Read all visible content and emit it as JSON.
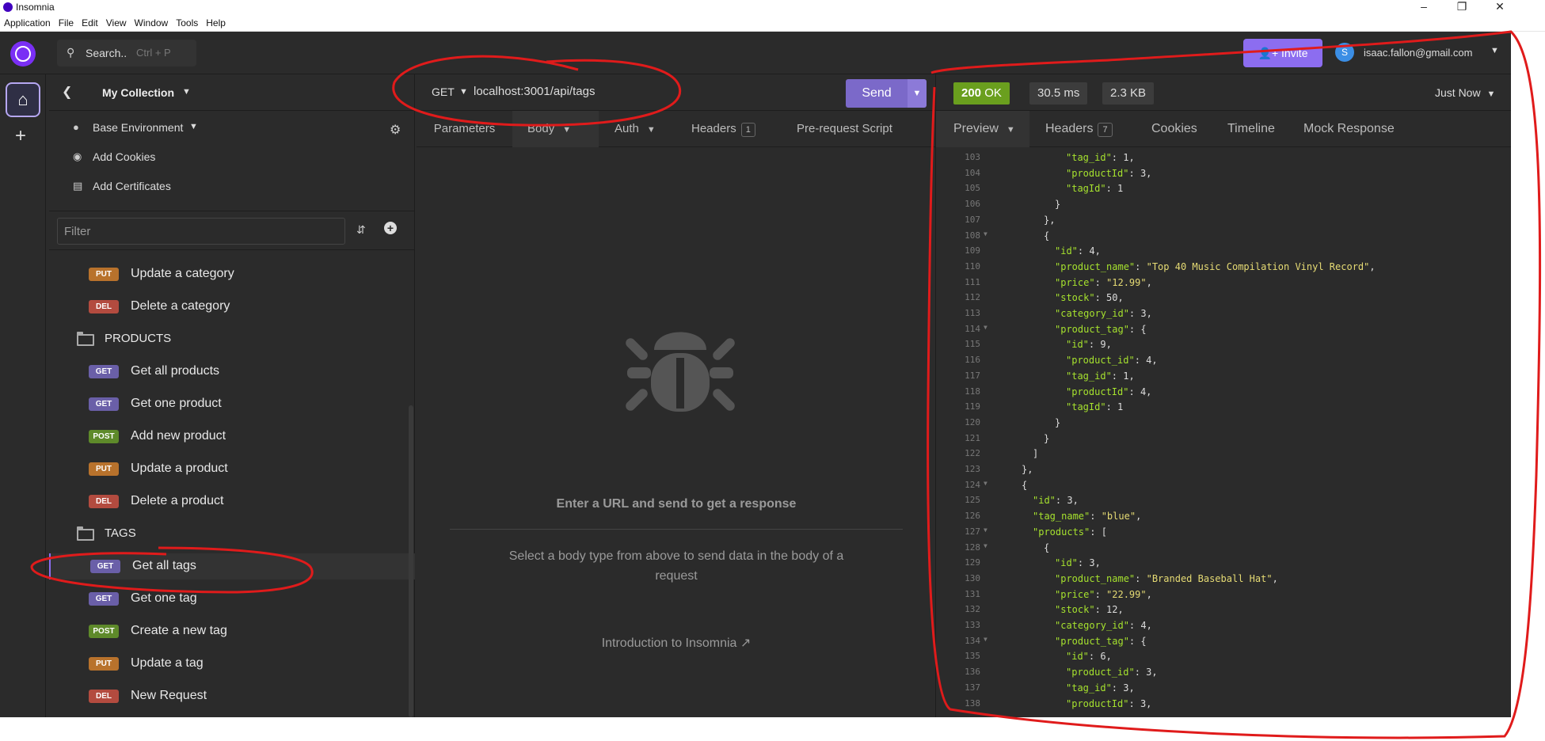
{
  "window": {
    "title": "Insomnia",
    "menu": [
      "Application",
      "File",
      "Edit",
      "View",
      "Window",
      "Tools",
      "Help"
    ]
  },
  "topbar": {
    "search_label": "Search..",
    "search_shortcut": "Ctrl + P",
    "invite_label": "Invite",
    "user_initial": "S",
    "user_email": "isaac.fallon@gmail.com"
  },
  "sidebar": {
    "collection_name": "My Collection",
    "environment": "Base Environment",
    "add_cookies": "Add Cookies",
    "add_certificates": "Add Certificates",
    "filter_placeholder": "Filter",
    "tree": [
      {
        "kind": "request",
        "method": "PUT",
        "label": "Update a category"
      },
      {
        "kind": "request",
        "method": "DEL",
        "label": "Delete a category"
      },
      {
        "kind": "folder",
        "label": "PRODUCTS"
      },
      {
        "kind": "request",
        "method": "GET",
        "label": "Get all products"
      },
      {
        "kind": "request",
        "method": "GET",
        "label": "Get one product"
      },
      {
        "kind": "request",
        "method": "POST",
        "label": "Add new product"
      },
      {
        "kind": "request",
        "method": "PUT",
        "label": "Update a product"
      },
      {
        "kind": "request",
        "method": "DEL",
        "label": "Delete a product"
      },
      {
        "kind": "folder",
        "label": "TAGS"
      },
      {
        "kind": "request",
        "method": "GET",
        "label": "Get all tags",
        "active": true
      },
      {
        "kind": "request",
        "method": "GET",
        "label": "Get one tag"
      },
      {
        "kind": "request",
        "method": "POST",
        "label": "Create a new tag"
      },
      {
        "kind": "request",
        "method": "PUT",
        "label": "Update a tag"
      },
      {
        "kind": "request",
        "method": "DEL",
        "label": "New Request"
      }
    ]
  },
  "request": {
    "method": "GET",
    "url": "localhost:3001/api/tags",
    "send_label": "Send",
    "tabs": {
      "parameters": "Parameters",
      "body": "Body",
      "auth": "Auth",
      "headers": "Headers",
      "headers_count": "1",
      "pre_request": "Pre-request Script"
    },
    "empty_title": "Enter a URL and send to get a response",
    "empty_subtitle": "Select a body type from above to send data in the body of a request",
    "intro_link": "Introduction to Insomnia"
  },
  "response": {
    "status_code": "200",
    "status_text": "OK",
    "time": "30.5 ms",
    "size": "2.3 KB",
    "when": "Just Now",
    "tabs": {
      "preview": "Preview",
      "headers": "Headers",
      "headers_count": "7",
      "cookies": "Cookies",
      "timeline": "Timeline",
      "mock": "Mock Response"
    },
    "lines": [
      {
        "n": "103",
        "indent": 6,
        "key": "tag_id",
        "val": "1",
        "vt": "num",
        "tail": ","
      },
      {
        "n": "104",
        "indent": 6,
        "key": "productId",
        "val": "3",
        "vt": "num",
        "tail": ","
      },
      {
        "n": "105",
        "indent": 6,
        "key": "tagId",
        "val": "1",
        "vt": "num",
        "tail": ""
      },
      {
        "n": "106",
        "indent": 5,
        "text": "}"
      },
      {
        "n": "107",
        "indent": 4,
        "text": "},"
      },
      {
        "n": "108",
        "indent": 4,
        "text": "{",
        "fold": true
      },
      {
        "n": "109",
        "indent": 5,
        "key": "id",
        "val": "4",
        "vt": "num",
        "tail": ","
      },
      {
        "n": "110",
        "indent": 5,
        "key": "product_name",
        "val": "\"Top 40 Music Compilation Vinyl Record\"",
        "vt": "str",
        "tail": ","
      },
      {
        "n": "111",
        "indent": 5,
        "key": "price",
        "val": "\"12.99\"",
        "vt": "str",
        "tail": ","
      },
      {
        "n": "112",
        "indent": 5,
        "key": "stock",
        "val": "50",
        "vt": "num",
        "tail": ","
      },
      {
        "n": "113",
        "indent": 5,
        "key": "category_id",
        "val": "3",
        "vt": "num",
        "tail": ","
      },
      {
        "n": "114",
        "indent": 5,
        "key": "product_tag",
        "val": "{",
        "vt": "punc",
        "tail": "",
        "fold": true
      },
      {
        "n": "115",
        "indent": 6,
        "key": "id",
        "val": "9",
        "vt": "num",
        "tail": ","
      },
      {
        "n": "116",
        "indent": 6,
        "key": "product_id",
        "val": "4",
        "vt": "num",
        "tail": ","
      },
      {
        "n": "117",
        "indent": 6,
        "key": "tag_id",
        "val": "1",
        "vt": "num",
        "tail": ","
      },
      {
        "n": "118",
        "indent": 6,
        "key": "productId",
        "val": "4",
        "vt": "num",
        "tail": ","
      },
      {
        "n": "119",
        "indent": 6,
        "key": "tagId",
        "val": "1",
        "vt": "num",
        "tail": ""
      },
      {
        "n": "120",
        "indent": 5,
        "text": "}"
      },
      {
        "n": "121",
        "indent": 4,
        "text": "}"
      },
      {
        "n": "122",
        "indent": 3,
        "text": "]"
      },
      {
        "n": "123",
        "indent": 2,
        "text": "},"
      },
      {
        "n": "124",
        "indent": 2,
        "text": "{",
        "fold": true
      },
      {
        "n": "125",
        "indent": 3,
        "key": "id",
        "val": "3",
        "vt": "num",
        "tail": ","
      },
      {
        "n": "126",
        "indent": 3,
        "key": "tag_name",
        "val": "\"blue\"",
        "vt": "str",
        "tail": ","
      },
      {
        "n": "127",
        "indent": 3,
        "key": "products",
        "val": "[",
        "vt": "punc",
        "tail": "",
        "fold": true
      },
      {
        "n": "128",
        "indent": 4,
        "text": "{",
        "fold": true
      },
      {
        "n": "129",
        "indent": 5,
        "key": "id",
        "val": "3",
        "vt": "num",
        "tail": ","
      },
      {
        "n": "130",
        "indent": 5,
        "key": "product_name",
        "val": "\"Branded Baseball Hat\"",
        "vt": "str",
        "tail": ","
      },
      {
        "n": "131",
        "indent": 5,
        "key": "price",
        "val": "\"22.99\"",
        "vt": "str",
        "tail": ","
      },
      {
        "n": "132",
        "indent": 5,
        "key": "stock",
        "val": "12",
        "vt": "num",
        "tail": ","
      },
      {
        "n": "133",
        "indent": 5,
        "key": "category_id",
        "val": "4",
        "vt": "num",
        "tail": ","
      },
      {
        "n": "134",
        "indent": 5,
        "key": "product_tag",
        "val": "{",
        "vt": "punc",
        "tail": "",
        "fold": true
      },
      {
        "n": "135",
        "indent": 6,
        "key": "id",
        "val": "6",
        "vt": "num",
        "tail": ","
      },
      {
        "n": "136",
        "indent": 6,
        "key": "product_id",
        "val": "3",
        "vt": "num",
        "tail": ","
      },
      {
        "n": "137",
        "indent": 6,
        "key": "tag_id",
        "val": "3",
        "vt": "num",
        "tail": ","
      },
      {
        "n": "138",
        "indent": 6,
        "key": "productId",
        "val": "3",
        "vt": "num",
        "tail": ","
      }
    ]
  },
  "colors": {
    "accent": "#8c6df0",
    "status_ok": "#6a9f1e",
    "get": "#6a5fa8",
    "put": "#b8722c",
    "del": "#b34b3f",
    "post": "#5e8a2a",
    "annotation": "#e01b1b"
  }
}
